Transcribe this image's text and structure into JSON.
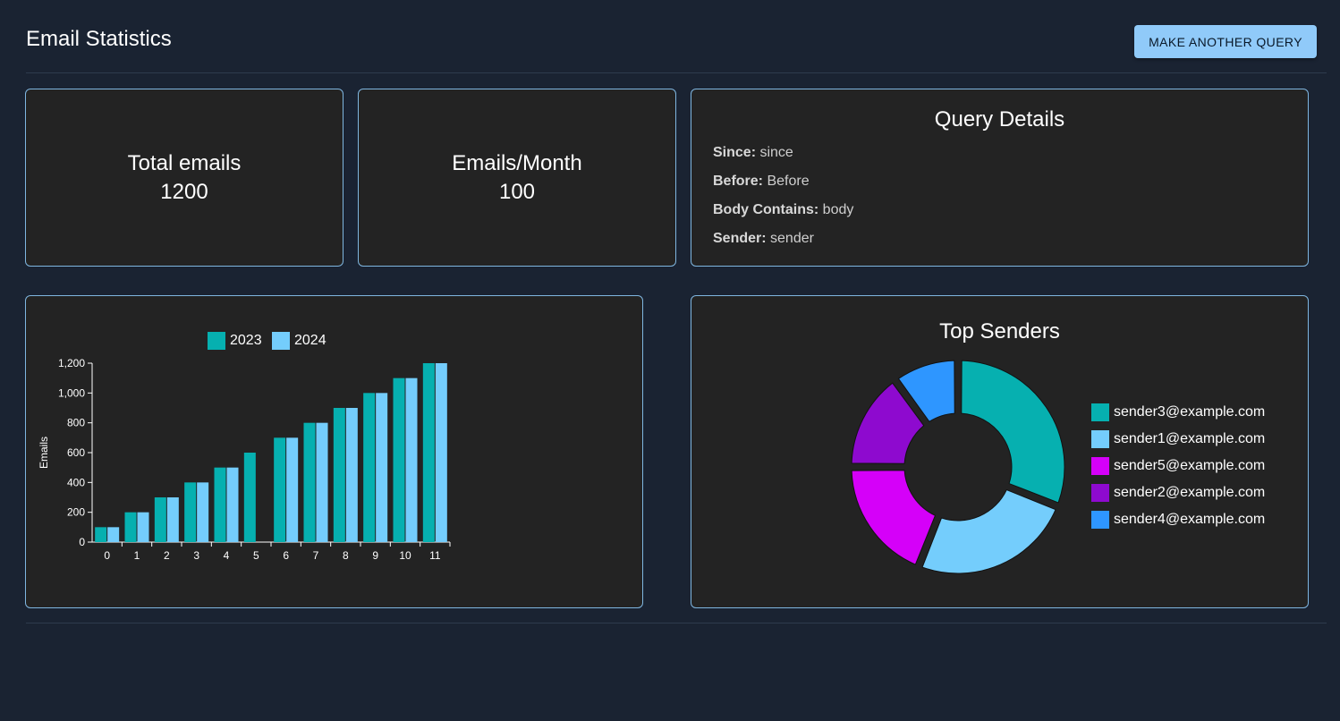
{
  "header": {
    "title": "Email Statistics",
    "query_button": "MAKE ANOTHER QUERY"
  },
  "stats": [
    {
      "label": "Total emails",
      "value": "1200"
    },
    {
      "label": "Emails/Month",
      "value": "100"
    }
  ],
  "query_details": {
    "title": "Query Details",
    "rows": [
      {
        "key": "Since:",
        "value": "since"
      },
      {
        "key": "Before:",
        "value": "Before"
      },
      {
        "key": "Body Contains:",
        "value": "body"
      },
      {
        "key": "Sender:",
        "value": "sender"
      }
    ]
  },
  "colors": {
    "accent": "#90caf9",
    "card_border": "#7fb6e0",
    "series_2023": "#06b0b0",
    "series_2024": "#74cdfc"
  },
  "chart_data": [
    {
      "type": "bar",
      "title": "",
      "xlabel": "",
      "ylabel": "Emails",
      "categories": [
        "0",
        "1",
        "2",
        "3",
        "4",
        "5",
        "6",
        "7",
        "8",
        "9",
        "10",
        "11"
      ],
      "series": [
        {
          "name": "2023",
          "color": "#06b0b0",
          "values": [
            100,
            200,
            300,
            400,
            500,
            600,
            700,
            800,
            900,
            1000,
            1100,
            1200
          ]
        },
        {
          "name": "2024",
          "color": "#74cdfc",
          "values": [
            100,
            200,
            300,
            400,
            500,
            0,
            700,
            800,
            900,
            1000,
            1100,
            1200
          ]
        }
      ],
      "yticks": [
        "0",
        "200",
        "400",
        "600",
        "800",
        "1,000",
        "1,200"
      ],
      "ylim": [
        0,
        1200
      ],
      "legend": "top",
      "grid": false
    },
    {
      "type": "pie",
      "title": "Top Senders",
      "legend": "right",
      "slices": [
        {
          "label": "sender3@example.com",
          "value": 31,
          "color": "#06b0b0"
        },
        {
          "label": "sender1@example.com",
          "value": 25,
          "color": "#74cdfc"
        },
        {
          "label": "sender5@example.com",
          "value": 19,
          "color": "#d500f9"
        },
        {
          "label": "sender2@example.com",
          "value": 15,
          "color": "#8e0acf"
        },
        {
          "label": "sender4@example.com",
          "value": 10,
          "color": "#2e96ff"
        }
      ]
    }
  ]
}
